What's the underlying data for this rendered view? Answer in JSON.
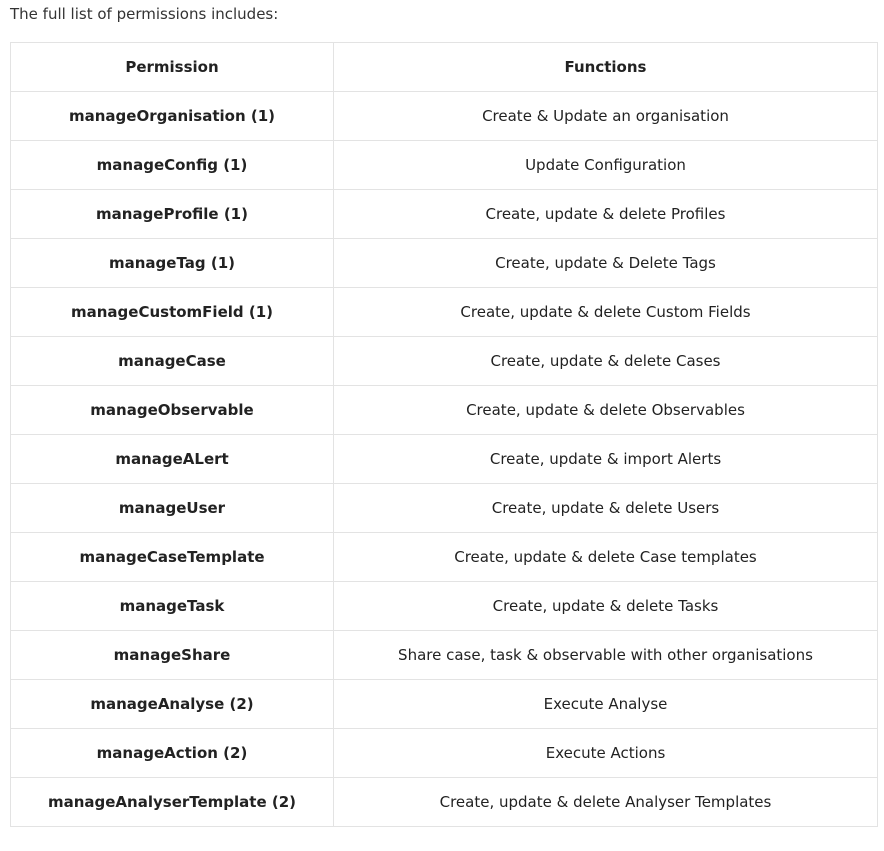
{
  "intro_text": "The full list of permissions includes:",
  "table": {
    "headers": [
      "Permission",
      "Functions"
    ],
    "rows": [
      {
        "permission": "manageOrganisation (1)",
        "function": "Create & Update an organisation"
      },
      {
        "permission": "manageConfig (1)",
        "function": "Update Configuration"
      },
      {
        "permission": "manageProfile (1)",
        "function": "Create, update & delete Profiles"
      },
      {
        "permission": "manageTag (1)",
        "function": "Create, update & Delete Tags"
      },
      {
        "permission": "manageCustomField (1)",
        "function": "Create, update & delete Custom Fields"
      },
      {
        "permission": "manageCase",
        "function": "Create, update & delete Cases"
      },
      {
        "permission": "manageObservable",
        "function": "Create, update & delete Observables"
      },
      {
        "permission": "manageALert",
        "function": "Create, update & import Alerts"
      },
      {
        "permission": "manageUser",
        "function": "Create, update & delete Users"
      },
      {
        "permission": "manageCaseTemplate",
        "function": "Create, update & delete Case templates"
      },
      {
        "permission": "manageTask",
        "function": "Create, update & delete Tasks"
      },
      {
        "permission": "manageShare",
        "function": "Share case, task & observable with other organisations"
      },
      {
        "permission": "manageAnalyse (2)",
        "function": "Execute Analyse"
      },
      {
        "permission": "manageAction (2)",
        "function": "Execute Actions"
      },
      {
        "permission": "manageAnalyserTemplate (2)",
        "function": "Create, update & delete Analyser Templates"
      }
    ]
  }
}
